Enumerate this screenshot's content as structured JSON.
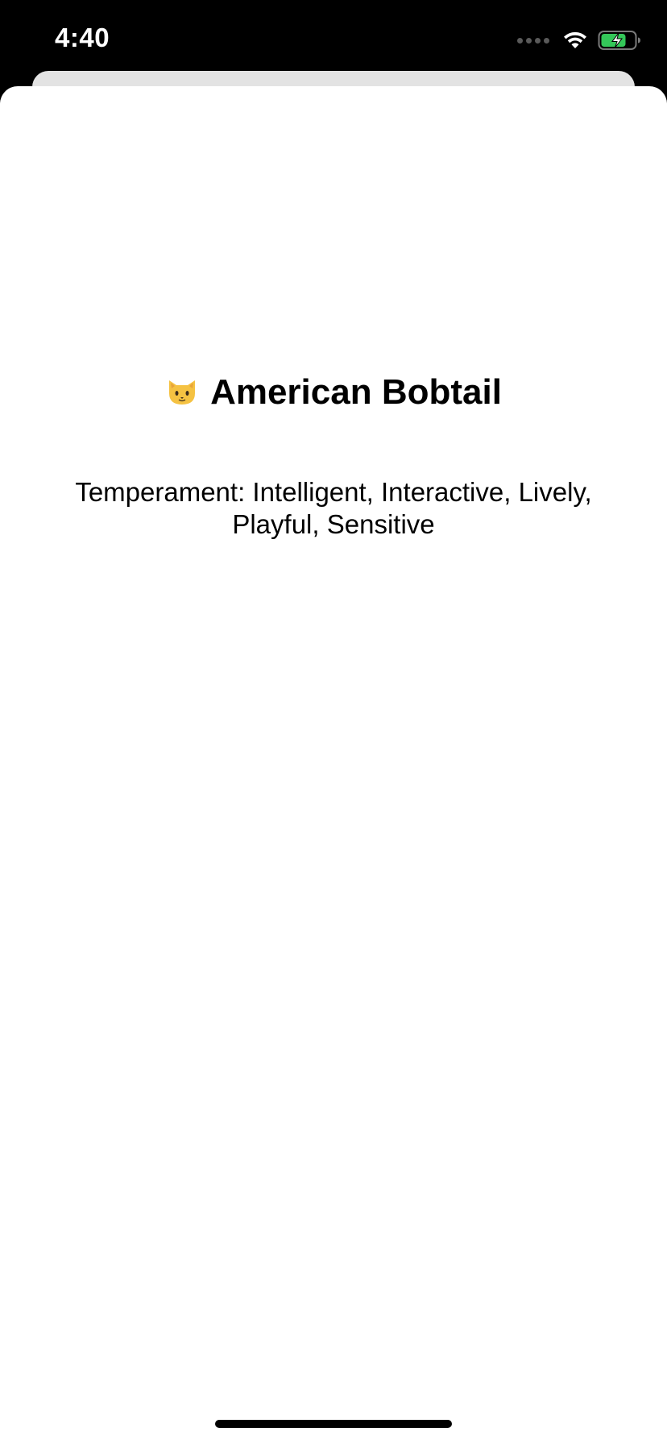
{
  "status_bar": {
    "time": "4:40",
    "icons": [
      "cellular-signal-icon",
      "wifi-icon",
      "battery-charging-icon"
    ],
    "battery_color": "#34c759"
  },
  "breed": {
    "icon": "cat-face-icon",
    "name": "American Bobtail",
    "temperament_text": "Temperament: Intelligent, Interactive, Lively, Playful, Sensitive"
  }
}
